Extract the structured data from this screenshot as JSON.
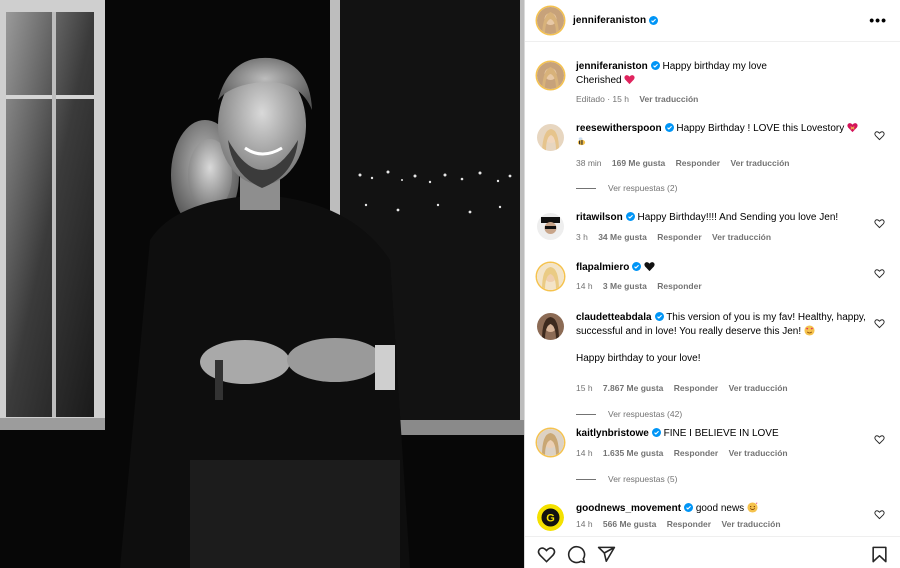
{
  "header": {
    "username": "jenniferaniston",
    "more_icon": "more-horizontal-icon"
  },
  "caption": {
    "username": "jenniferaniston",
    "text_line1": "Happy birthday my love",
    "text_line2": "Cherished",
    "edited": "Editado · 15 h",
    "translate": "Ver traducción"
  },
  "comments": [
    {
      "username": "reesewitherspoon",
      "text": "Happy Birthday ! LOVE this Lovestory",
      "time": "38 min",
      "likes": "169 Me gusta",
      "reply": "Responder",
      "translate": "Ver traducción",
      "view_replies": "Ver respuestas (2)"
    },
    {
      "username": "ritawilson",
      "text": "Happy Birthday!!!! And Sending you love Jen!",
      "time": "3 h",
      "likes": "34 Me gusta",
      "reply": "Responder",
      "translate": "Ver traducción"
    },
    {
      "username": "flapalmiero",
      "text": "",
      "time": "14 h",
      "likes": "3 Me gusta",
      "reply": "Responder"
    },
    {
      "username": "claudetteabdala",
      "text": "This version of you is my fav! Healthy, happy, successful and in love! You really deserve this Jen!",
      "text2": "Happy birthday to your love!",
      "time": "15 h",
      "likes": "7.867 Me gusta",
      "reply": "Responder",
      "translate": "Ver traducción",
      "view_replies": "Ver respuestas (42)"
    },
    {
      "username": "kaitlynbristowe",
      "text": "FINE I BELIEVE IN LOVE",
      "time": "14 h",
      "likes": "1.635 Me gusta",
      "reply": "Responder",
      "translate": "Ver traducción",
      "view_replies": "Ver respuestas (5)"
    },
    {
      "username": "goodnews_movement",
      "text": "good news",
      "time": "14 h",
      "likes": "566 Me gusta",
      "reply": "Responder",
      "translate": "Ver traducción"
    }
  ],
  "actions": {
    "like_icon": "heart-icon",
    "comment_icon": "comment-icon",
    "share_icon": "share-icon",
    "save_icon": "bookmark-icon"
  },
  "colors": {
    "verified": "#0095f6",
    "meta_text": "#737373",
    "border": "#dbdbdb",
    "story_ring": "#f5c24d",
    "heart_red": "#e0245e"
  }
}
